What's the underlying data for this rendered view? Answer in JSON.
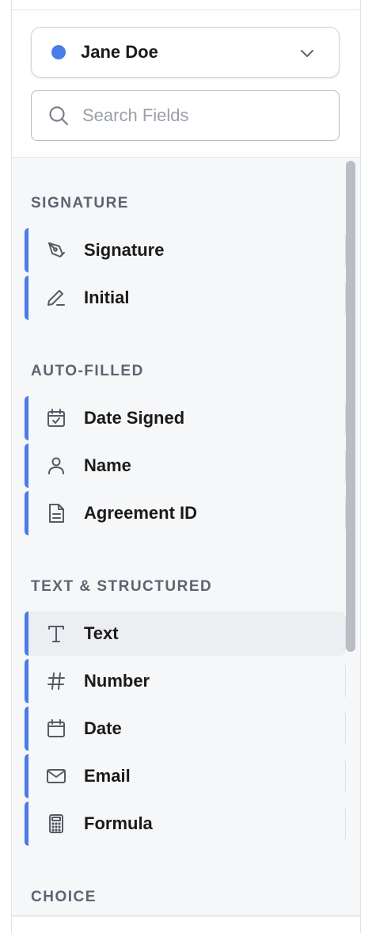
{
  "signer": {
    "name": "Jane Doe",
    "color": "#4a7bea"
  },
  "search": {
    "placeholder": "Search Fields",
    "value": ""
  },
  "sections": {
    "signature": {
      "title": "SIGNATURE",
      "items": [
        {
          "label": "Signature",
          "icon": "pen-nib-icon"
        },
        {
          "label": "Initial",
          "icon": "pencil-icon"
        }
      ]
    },
    "auto_filled": {
      "title": "AUTO-FILLED",
      "items": [
        {
          "label": "Date Signed",
          "icon": "calendar-check-icon"
        },
        {
          "label": "Name",
          "icon": "user-icon"
        },
        {
          "label": "Agreement ID",
          "icon": "document-icon"
        }
      ]
    },
    "text_structured": {
      "title": "TEXT & STRUCTURED",
      "items": [
        {
          "label": "Text",
          "icon": "text-t-icon"
        },
        {
          "label": "Number",
          "icon": "hash-icon"
        },
        {
          "label": "Date",
          "icon": "calendar-icon"
        },
        {
          "label": "Email",
          "icon": "envelope-icon"
        },
        {
          "label": "Formula",
          "icon": "calculator-icon"
        }
      ]
    },
    "choice": {
      "title": "CHOICE"
    }
  },
  "colors": {
    "accent": "#4a7bea",
    "section_title": "#5c6470",
    "list_background": "#f6f7f9"
  }
}
